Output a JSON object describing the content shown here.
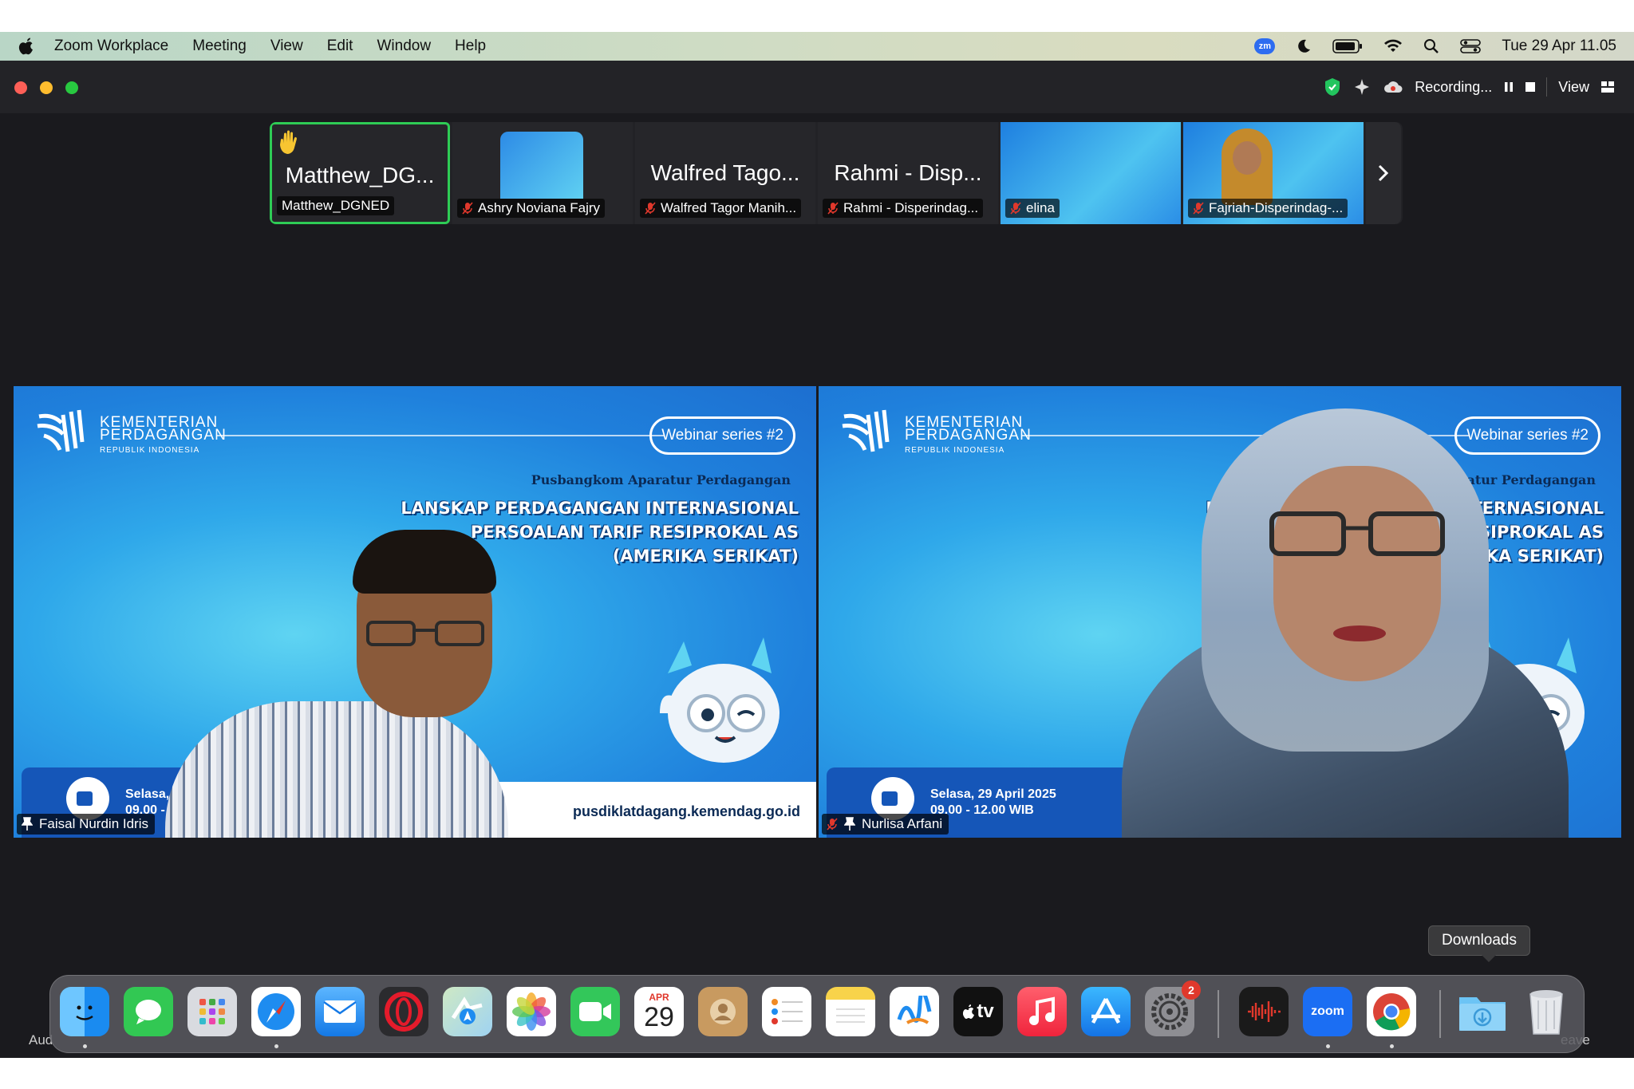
{
  "menubar": {
    "app_name": "Zoom Workplace",
    "items": [
      "Meeting",
      "View",
      "Edit",
      "Window",
      "Help"
    ],
    "clock": "Tue 29 Apr  11.05",
    "zoom_status_label": "zm"
  },
  "toolbar": {
    "recording_label": "Recording...",
    "view_label": "View"
  },
  "thumbnails": [
    {
      "big": "Matthew_DG...",
      "name": "Matthew_DGNED"
    },
    {
      "big": "",
      "name": "Ashry Noviana Fajry"
    },
    {
      "big": "Walfred Tago...",
      "name": "Walfred Tagor Manih..."
    },
    {
      "big": "Rahmi - Disp...",
      "name": "Rahmi - Disperindag..."
    },
    {
      "big": "",
      "name": "elina"
    },
    {
      "big": "",
      "name": "Fajriah-Disperindag-..."
    }
  ],
  "slide": {
    "ministry_line1": "KEMENTERIAN",
    "ministry_line2": "PERDAGANGAN",
    "ministry_line3": "REPUBLIK INDONESIA",
    "badge": "Webinar series #2",
    "org": "Pusbangkom Aparatur Perdagangan",
    "title_line1": "LANSKAP PERDAGANGAN INTERNASIONAL",
    "title_line2": "PERSOALAN TARIF RESIPROKAL AS",
    "title_line3": "(AMERIKA SERIKAT)",
    "date": "Selasa, 29 April 2025",
    "time": "09.00 - 12.00 WIB",
    "url": "pusdiklatdagang.kemendag.go.id"
  },
  "video_left": {
    "name": "Faisal Nurdin Idris"
  },
  "video_right": {
    "name": "Nurlisa Arfani"
  },
  "dock": {
    "tooltip": "Downloads",
    "calendar_month": "APR",
    "calendar_day": "29",
    "settings_badge": "2",
    "zoom_label": "zoom",
    "tv_label": "tv",
    "left_edge_text": "Aud",
    "right_edge_text": "eave"
  }
}
